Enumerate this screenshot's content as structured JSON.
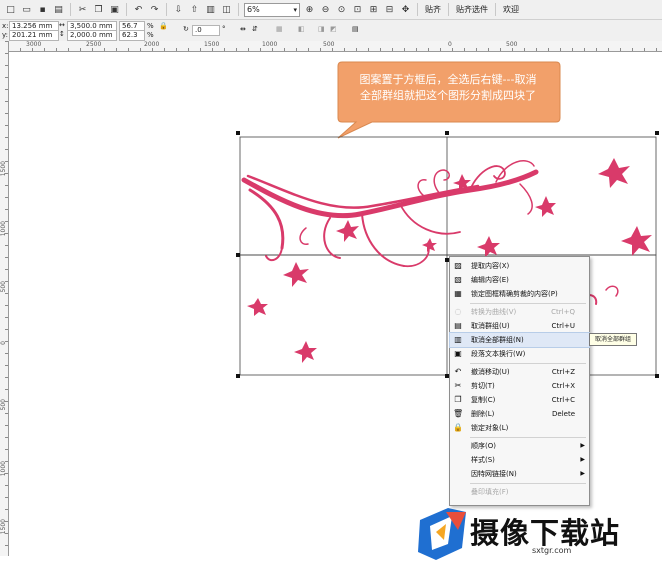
{
  "toolbar": {
    "zoom": "6%",
    "buttons": [
      "new-icon",
      "open-icon",
      "save-icon",
      "print-icon",
      "cut-icon",
      "copy-icon",
      "paste-icon",
      "undo-icon",
      "redo-icon",
      "import-icon",
      "export-icon",
      "publish-icon",
      "app-launcher-icon",
      "zoom-in-icon",
      "zoom-out-icon",
      "zoom-fit-icon",
      "zoom-page-icon",
      "zoom-width-icon",
      "zoom-height-icon",
      "pan-icon",
      "snap-icon",
      "options-icon"
    ],
    "snap_label": "贴齐",
    "snap_options_label": "贴齐选件",
    "welcome_label": "欢迎"
  },
  "propbar": {
    "x_label": "x:",
    "x_value": "13.256 mm",
    "y_label": "y:",
    "y_value": "201.21 mm",
    "width_value": "3,500.0 mm",
    "height_value": "2,000.0 mm",
    "scale_x": "56.7",
    "scale_y": "62.3",
    "percent": "%",
    "rotation": ".0",
    "degree": "°"
  },
  "ruler_top": [
    "3000",
    "2500",
    "2000",
    "1500",
    "1000",
    "500",
    "0",
    "500"
  ],
  "ruler_left": [
    "1500",
    "1000",
    "500",
    "0",
    "500",
    "1000",
    "1500",
    "2000"
  ],
  "callout": {
    "line1": "图案置于方框后，全选后右键---取消",
    "line2": "全部群组就把这个图形分割成四块了",
    "fill": "#f2a06a"
  },
  "artwork": {
    "color": "#d93a6a"
  },
  "context_menu": {
    "items": [
      {
        "icon": "extract-icon",
        "label": "提取内容(X)",
        "shortcut": "",
        "disabled": false,
        "arrow": false
      },
      {
        "icon": "edit-contents-icon",
        "label": "编辑内容(E)",
        "shortcut": "",
        "disabled": false,
        "arrow": false
      },
      {
        "icon": "lock-contents-icon",
        "label": "锁定图框精确剪裁的内容(P)",
        "shortcut": "",
        "disabled": false,
        "arrow": false
      },
      {
        "icon": "convert-curve-icon",
        "label": "转换为曲线(V)",
        "shortcut": "Ctrl+Q",
        "disabled": true,
        "arrow": false
      },
      {
        "icon": "ungroup-icon",
        "label": "取消群组(U)",
        "shortcut": "Ctrl+U",
        "disabled": false,
        "arrow": false
      },
      {
        "icon": "ungroup-all-icon",
        "label": "取消全部群组(N)",
        "shortcut": "",
        "disabled": false,
        "arrow": false,
        "highlighted": true
      },
      {
        "icon": "text-wrap-icon",
        "label": "段落文本换行(W)",
        "shortcut": "",
        "disabled": false,
        "arrow": false
      },
      {
        "icon": "undo-icon",
        "label": "撤消移动(U)",
        "shortcut": "Ctrl+Z",
        "disabled": false,
        "arrow": false
      },
      {
        "icon": "cut-icon",
        "label": "剪切(T)",
        "shortcut": "Ctrl+X",
        "disabled": false,
        "arrow": false
      },
      {
        "icon": "copy-icon",
        "label": "复制(C)",
        "shortcut": "Ctrl+C",
        "disabled": false,
        "arrow": false
      },
      {
        "icon": "delete-icon",
        "label": "删除(L)",
        "shortcut": "Delete",
        "disabled": false,
        "arrow": false
      },
      {
        "icon": "lock-icon",
        "label": "锁定对象(L)",
        "shortcut": "",
        "disabled": false,
        "arrow": false
      },
      {
        "icon": "",
        "label": "顺序(O)",
        "shortcut": "",
        "disabled": false,
        "arrow": true
      },
      {
        "icon": "",
        "label": "样式(S)",
        "shortcut": "",
        "disabled": false,
        "arrow": true
      },
      {
        "icon": "",
        "label": "因特网链接(N)",
        "shortcut": "",
        "disabled": false,
        "arrow": true
      },
      {
        "icon": "",
        "label": "叠印填充(F)",
        "shortcut": "",
        "disabled": true,
        "arrow": false
      }
    ],
    "tooltip": "取消全部群组"
  },
  "watermark": {
    "title": "摄像下载站",
    "url": "sxtgr.com"
  }
}
